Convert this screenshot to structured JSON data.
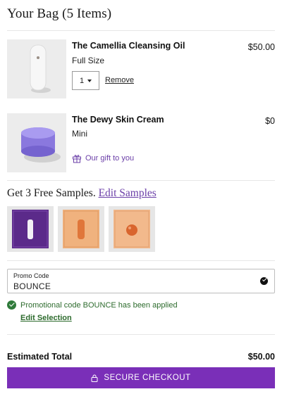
{
  "bag": {
    "title": "Your Bag (5 Items)"
  },
  "items": [
    {
      "name": "The Camellia Cleansing Oil",
      "variant": "Full Size",
      "price": "$50.00",
      "quantity": "1",
      "remove_label": "Remove"
    },
    {
      "name": "The Dewy Skin Cream",
      "variant": "Mini",
      "price": "$0",
      "gift_label": "Our gift to you"
    }
  ],
  "samples": {
    "heading": "Get 3 Free Samples.",
    "edit_link": "Edit Samples",
    "cards": [
      {
        "color": "#5b2a8a"
      },
      {
        "color": "#f0b27e"
      },
      {
        "color": "#f2b98c"
      }
    ]
  },
  "promo": {
    "label": "Promo Code",
    "value": "BOUNCE",
    "applied_message": "Promotional code BOUNCE has been applied",
    "edit_label": "Edit Selection"
  },
  "summary": {
    "total_label": "Estimated Total",
    "total_value": "$50.00"
  },
  "checkout": {
    "label": "SECURE CHECKOUT"
  },
  "colors": {
    "accent": "#7a2fb8",
    "success": "#2f7a3a",
    "link": "#6b3fa8"
  }
}
